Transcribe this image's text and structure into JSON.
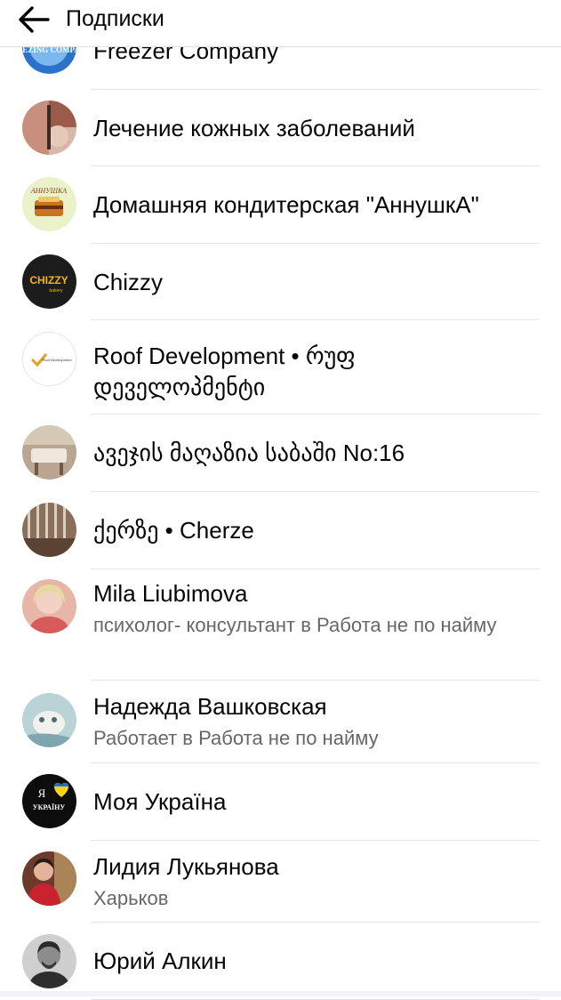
{
  "header": {
    "title": "Подписки",
    "back_icon": "arrow-left-icon"
  },
  "list": {
    "items": [
      {
        "name": "Freezer Company",
        "subtitle": "",
        "avatar": "freezing-company-logo"
      },
      {
        "name": "Лечение кожных заболеваний",
        "subtitle": "",
        "avatar": "skin-treatment-photo"
      },
      {
        "name": "Домашняя кондитерская \"АннушкА\"",
        "subtitle": "",
        "avatar": "annushka-logo"
      },
      {
        "name": "Chizzy",
        "subtitle": "",
        "avatar": "chizzy-logo"
      },
      {
        "name": "Roof Development • რუფ\nდეველოპმენტი",
        "subtitle": "",
        "avatar": "roof-development-logo"
      },
      {
        "name": "ავეჯის მაღაზია საბაში No:16",
        "subtitle": "",
        "avatar": "furniture-photo"
      },
      {
        "name": "ქერზე • Cherze",
        "subtitle": "",
        "avatar": "cherze-photo"
      },
      {
        "name": "Mila Liubimova",
        "subtitle": "психолог- консультант в Работа не по найму",
        "avatar": "user-photo"
      },
      {
        "name": "Надежда Вашковская",
        "subtitle": "Работает в Работа не по найму",
        "avatar": "user-photo"
      },
      {
        "name": "Моя Україна",
        "subtitle": "",
        "avatar": "ya-ukraina-logo"
      },
      {
        "name": "Лидия Лукьянова",
        "subtitle": "Харьков",
        "avatar": "user-photo"
      },
      {
        "name": "Юрий Алкин",
        "subtitle": "",
        "avatar": "user-photo"
      }
    ]
  },
  "avatar_logo_text": {
    "freezing": "FREEZING COMPANY",
    "annushka": "АННУШКА",
    "chizzy": "CHIZZY",
    "chizzy_sub": "bakery",
    "roof": "Roof Development",
    "ya": "Я",
    "ukraina": "УКРАЇНУ"
  },
  "colors": {
    "text_primary": "#050505",
    "text_secondary": "#65676b",
    "divider": "#e4e6eb"
  }
}
